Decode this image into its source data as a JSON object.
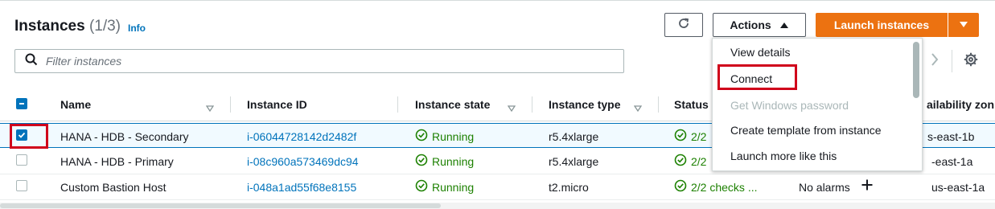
{
  "header": {
    "title": "Instances",
    "count": "(1/3)",
    "info_label": "Info",
    "actions_label": "Actions",
    "launch_label": "Launch instances"
  },
  "search": {
    "placeholder": "Filter instances"
  },
  "columns": {
    "name": "Name",
    "instance_id": "Instance ID",
    "instance_state": "Instance state",
    "instance_type": "Instance type",
    "status": "Status",
    "availability_zone": "ailability zon"
  },
  "rows": [
    {
      "name": "HANA - HDB - Secondary",
      "instance_id": "i-06044728142d2482f",
      "state": "Running",
      "type": "r5.4xlarge",
      "status": "2/2",
      "alarm": "",
      "az": "s-east-1b",
      "selected": true
    },
    {
      "name": "HANA - HDB - Primary",
      "instance_id": "i-08c960a573469dc94",
      "state": "Running",
      "type": "r5.4xlarge",
      "status": "2/2",
      "alarm": "",
      "az": "-east-1a",
      "selected": false
    },
    {
      "name": "Custom Bastion Host",
      "instance_id": "i-048a1ad55f68e8155",
      "state": "Running",
      "type": "t2.micro",
      "status": "2/2 checks ...",
      "alarm": "No alarms",
      "az": "us-east-1a",
      "selected": false
    }
  ],
  "actions_menu": {
    "items": [
      {
        "label": "View details",
        "disabled": false
      },
      {
        "label": "Connect",
        "disabled": false
      },
      {
        "label": "Get Windows password",
        "disabled": true
      },
      {
        "label": "Create template from instance",
        "disabled": false
      },
      {
        "label": "Launch more like this",
        "disabled": false
      }
    ]
  },
  "icons": {
    "refresh": "refresh-icon",
    "actions_caret": "caret-up-icon",
    "launch_caret": "caret-down-icon",
    "search": "search-icon",
    "next_page": "chevron-right-icon",
    "settings": "gear-icon",
    "running": "check-circle-icon",
    "add_alarm": "plus-icon",
    "sort": "sort-down-icon"
  },
  "colors": {
    "accent": "#0073bb",
    "primary_button": "#ec7211",
    "success": "#1d8102",
    "highlight_box": "#d0021b"
  }
}
